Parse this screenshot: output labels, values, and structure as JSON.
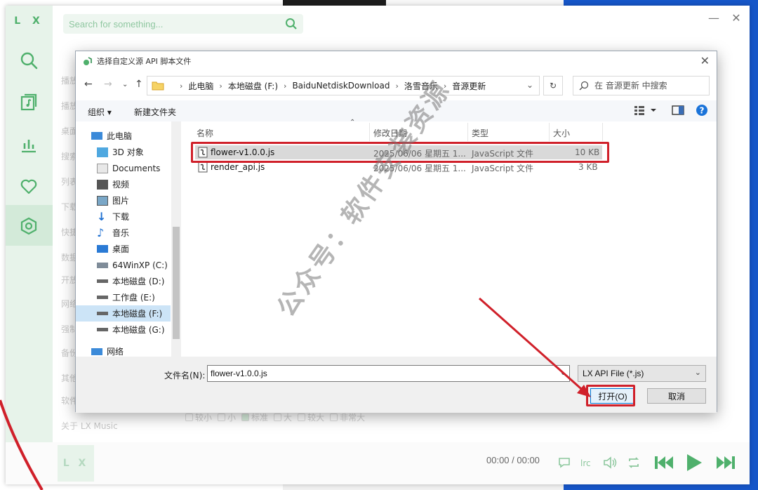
{
  "lx": {
    "logo": "L X",
    "search_placeholder": "Search for something...",
    "settings_items": [
      "播放",
      "播放",
      "桌面",
      "搜索",
      "列表",
      "下载",
      "快捷",
      "数据",
      "开放",
      "网络",
      "强制",
      "备份",
      "其他",
      "软件",
      "关于 LX Music"
    ],
    "radio_options": [
      "较小",
      "小",
      "标准",
      "大",
      "较大",
      "非常大"
    ],
    "player_logo": "L X",
    "time": "00:00 / 00:00",
    "accent": "#4fb06c"
  },
  "dialog": {
    "title": "选择自定义源 API 脚本文件",
    "breadcrumbs": [
      "此电脑",
      "本地磁盘 (F:)",
      "BaiduNetdiskDownload",
      "洛雪音乐",
      "音源更新"
    ],
    "search_placeholder": "在 音源更新 中搜索",
    "toolbar": {
      "organize": "组织 ▾",
      "new_folder": "新建文件夹"
    },
    "tree": [
      {
        "label": "此电脑",
        "icon": "computer-icon"
      },
      {
        "label": "3D 对象",
        "icon": "cube-icon"
      },
      {
        "label": "Documents",
        "icon": "document-icon"
      },
      {
        "label": "视频",
        "icon": "video-icon"
      },
      {
        "label": "图片",
        "icon": "picture-icon"
      },
      {
        "label": "下载",
        "icon": "download-icon"
      },
      {
        "label": "音乐",
        "icon": "music-icon"
      },
      {
        "label": "桌面",
        "icon": "desktop-icon"
      },
      {
        "label": "64WinXP  (C:)",
        "icon": "windows-drive-icon"
      },
      {
        "label": "本地磁盘 (D:)",
        "icon": "drive-icon"
      },
      {
        "label": "工作盘 (E:)",
        "icon": "drive-icon"
      },
      {
        "label": "本地磁盘 (F:)",
        "icon": "drive-icon"
      },
      {
        "label": "本地磁盘 (G:)",
        "icon": "drive-icon"
      },
      {
        "label": "网络",
        "icon": "network-icon"
      }
    ],
    "columns": {
      "name": "名称",
      "date": "修改日期",
      "type": "类型",
      "size": "大小"
    },
    "files": [
      {
        "name": "flower-v1.0.0.js",
        "date": "2025/06/06 星期五 1...",
        "type": "JavaScript 文件",
        "size": "10 KB"
      },
      {
        "name": "render_api.js",
        "date": "2025/06/06 星期五 1...",
        "type": "JavaScript 文件",
        "size": "3 KB"
      }
    ],
    "filename_label": "文件名(N):",
    "filename_value": "flower-v1.0.0.js",
    "filter": "LX API File (*.js)",
    "open_label": "打开(O)",
    "cancel_label": "取消",
    "highlight_color": "#d0202a"
  },
  "watermark": "公众号：软件安装资源"
}
